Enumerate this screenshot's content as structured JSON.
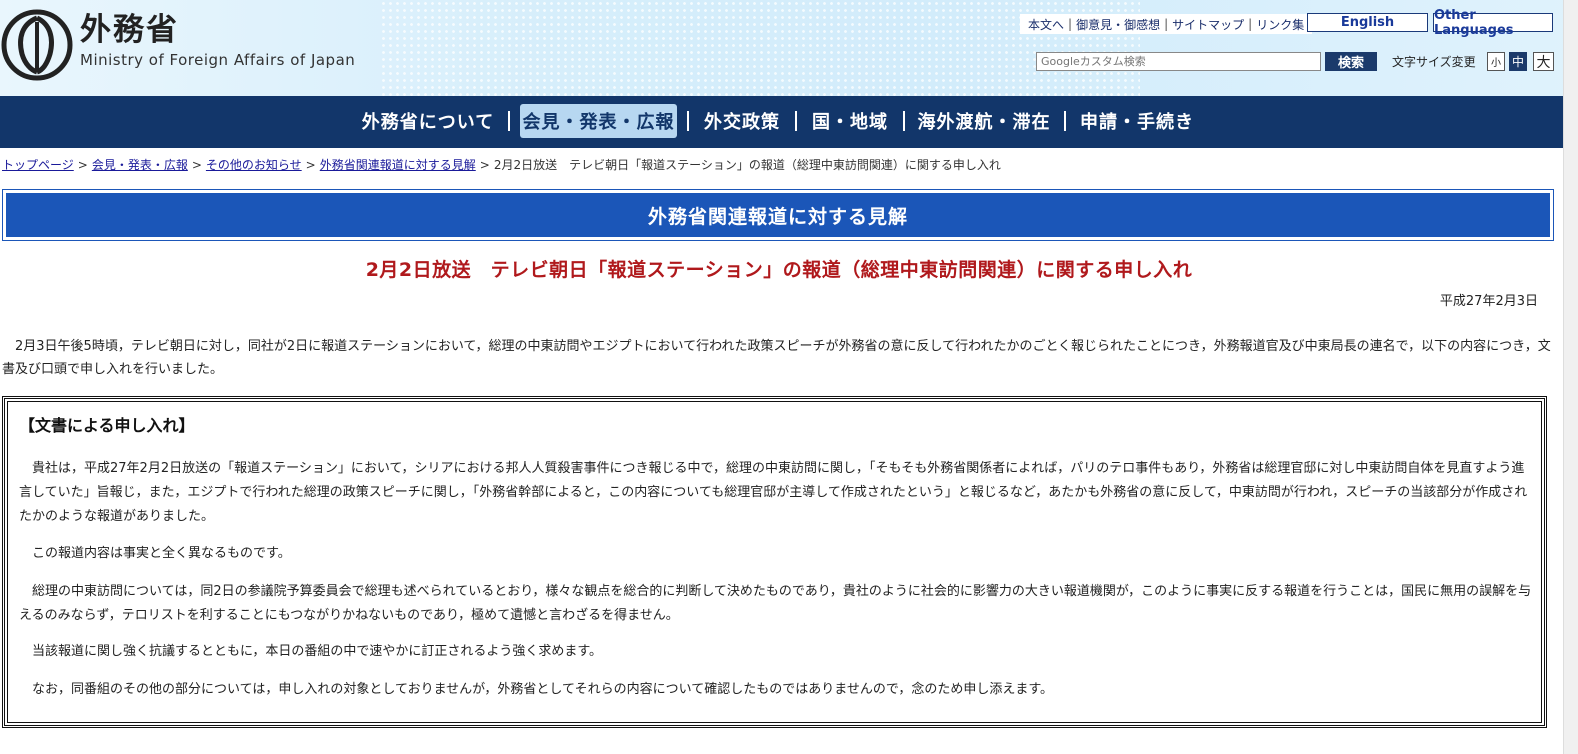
{
  "header": {
    "logo_ja": "外務省",
    "logo_en": "Ministry of Foreign Affairs of Japan",
    "util_links": [
      "本文へ",
      "御意見・御感想",
      "サイトマップ",
      "リンク集"
    ],
    "english_label": "English",
    "other_languages_label": "Other Languages",
    "search_placeholder": "Googleカスタム検索",
    "search_button": "検索",
    "fontsize_label": "文字サイズ変更",
    "fontsize_small": "小",
    "fontsize_mid": "中",
    "fontsize_large": "大"
  },
  "nav": {
    "items": [
      "外務省について",
      "会見・発表・広報",
      "外交政策",
      "国・地域",
      "海外渡航・滞在",
      "申請・手続き"
    ],
    "active_index": 1
  },
  "breadcrumb": {
    "links": [
      "トップページ",
      "会見・発表・広報",
      "その他のお知らせ",
      "外務省関連報道に対する見解"
    ],
    "separator": ">",
    "current": "2月2日放送　テレビ朝日「報道ステーション」の報道（総理中東訪問関連）に関する申し入れ"
  },
  "section_banner": "外務省関連報道に対する見解",
  "article": {
    "title": "2月2日放送　テレビ朝日「報道ステーション」の報道（総理中東訪問関連）に関する申し入れ",
    "date": "平成27年2月3日",
    "intro": "2月3日午後5時頃，テレビ朝日に対し，同社が2日に報道ステーションにおいて，総理の中東訪問やエジプトにおいて行われた政策スピーチが外務省の意に反して行われたかのごとく報じられたことにつき，外務報道官及び中東局長の連名で，以下の内容につき，文書及び口頭で申し入れを行いました。",
    "statement": {
      "heading": "【文書による申し入れ】",
      "paragraphs": [
        "貴社は，平成27年2月2日放送の「報道ステーション」において，シリアにおける邦人人質殺害事件につき報じる中で，総理の中東訪問に関し，「そもそも外務省関係者によれば，パリのテロ事件もあり，外務省は総理官邸に対し中東訪問自体を見直すよう進言していた」旨報じ，また，エジプトで行われた総理の政策スピーチに関し，「外務省幹部によると，この内容についても総理官邸が主導して作成されたという」と報じるなど，あたかも外務省の意に反して，中東訪問が行われ，スピーチの当該部分が作成されたかのような報道がありました。",
        "この報道内容は事実と全く異なるものです。",
        "総理の中東訪問については，同2日の参議院予算委員会で総理も述べられているとおり，様々な観点を総合的に判断して決めたものであり，貴社のように社会的に影響力の大きい報道機関が，このように事実に反する報道を行うことは，国民に無用の誤解を与えるのみならず，テロリストを利することにもつながりかねないものであり，極めて遺憾と言わざるを得ません。",
        "当該報道に関し強く抗議するとともに，本日の番組の中で速やかに訂正されるよう強く求めます。",
        "なお，同番組のその他の部分については，申し入れの対象としておりませんが，外務省としてそれらの内容について確認したものではありませんので，念のため申し添えます。"
      ]
    }
  },
  "colors": {
    "nav_bg": "#12366a",
    "banner_bg": "#1b56b8",
    "title_red": "#b0191c",
    "active_nav_bg": "#b7d7f1"
  }
}
